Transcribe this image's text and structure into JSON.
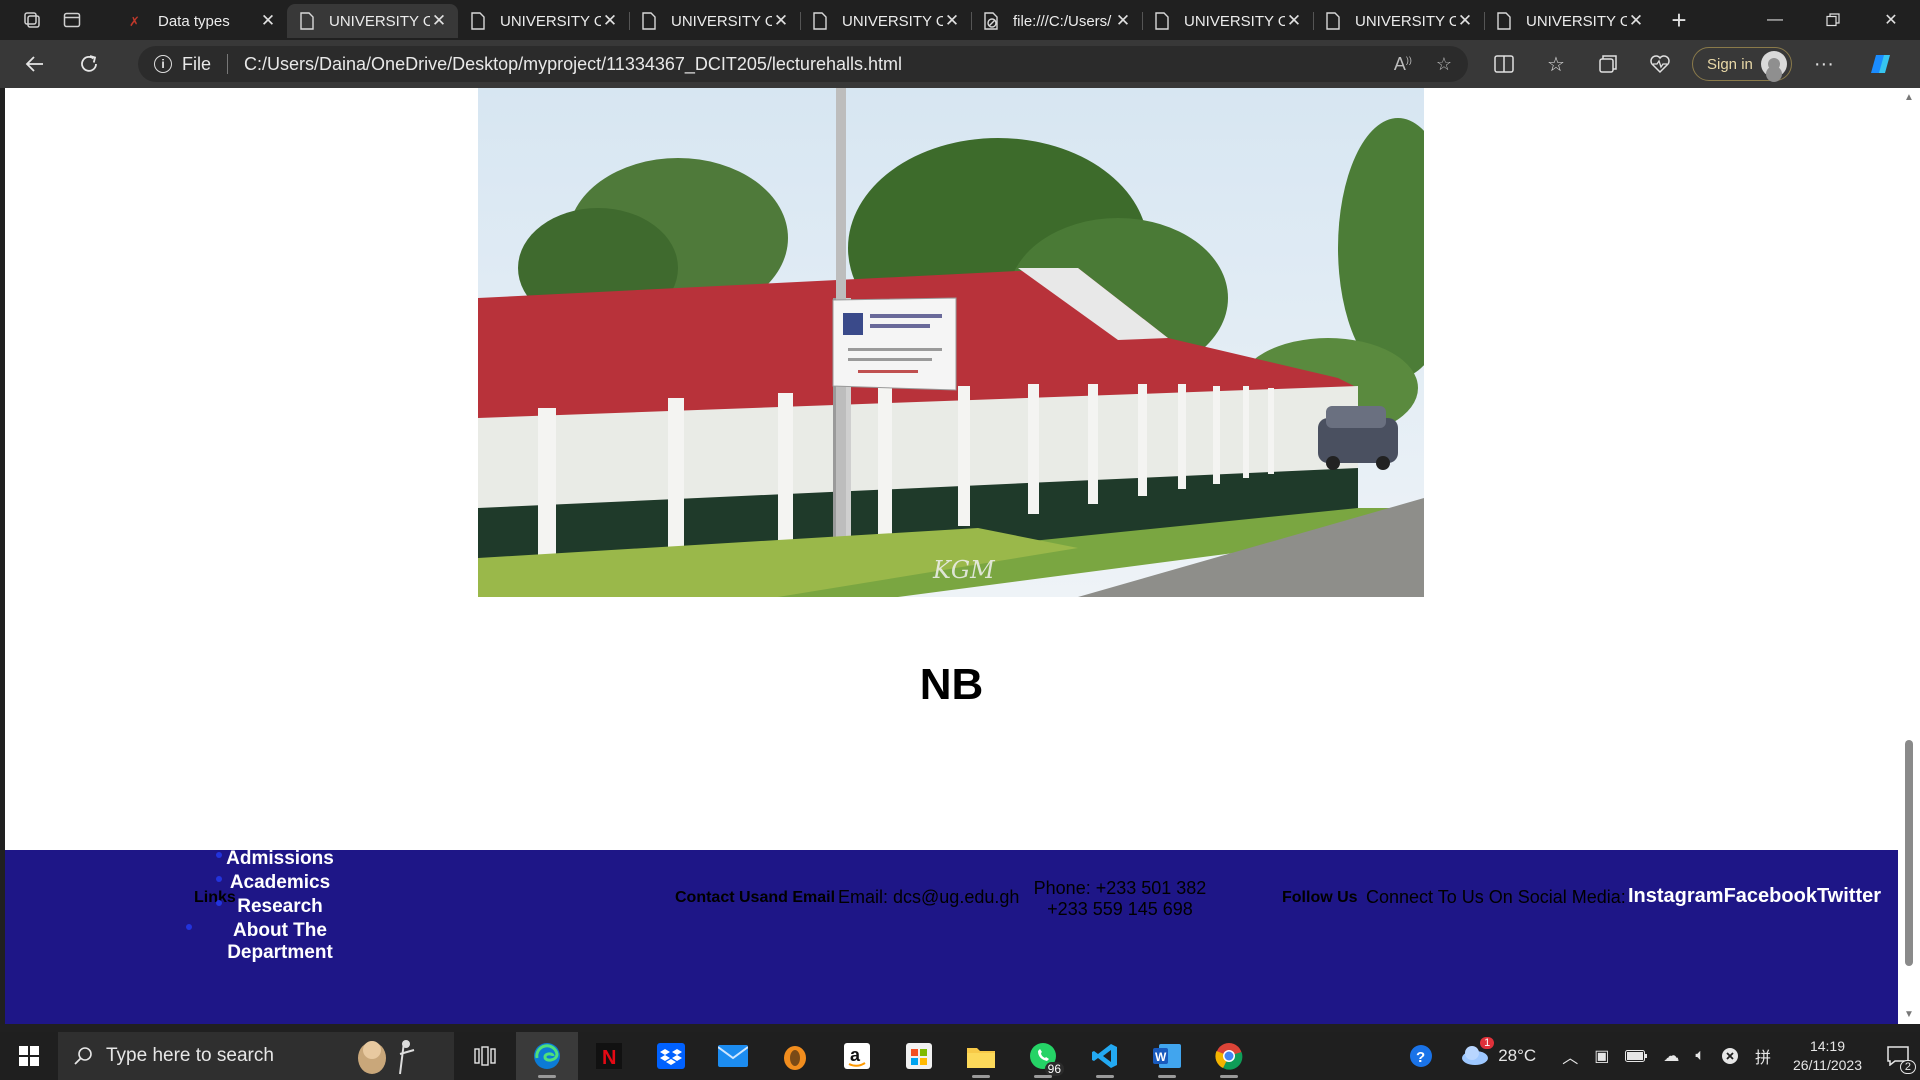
{
  "browser": {
    "tabs": [
      {
        "title": "Data types",
        "active": false,
        "icon": "app-favicon-red"
      },
      {
        "title": "UNIVERSITY OF GHANA",
        "active": true,
        "icon": "page-icon"
      },
      {
        "title": "UNIVERSITY OF GHANA",
        "active": false,
        "icon": "page-icon"
      },
      {
        "title": "UNIVERSITY OF GHANA",
        "active": false,
        "icon": "page-icon"
      },
      {
        "title": "UNIVERSITY OF GHANA",
        "active": false,
        "icon": "page-icon"
      },
      {
        "title": "file:///C:/Users/",
        "active": false,
        "icon": "file-blocked-icon"
      },
      {
        "title": "UNIVERSITY OF GHANA",
        "active": false,
        "icon": "page-icon"
      },
      {
        "title": "UNIVERSITY OF GHANA",
        "active": false,
        "icon": "page-icon"
      },
      {
        "title": "UNIVERSITY OF GHANA",
        "active": false,
        "icon": "page-icon"
      }
    ],
    "address": {
      "scheme_label": "File",
      "url": "C:/Users/Daina/OneDrive/Desktop/myproject/11334367_DCIT205/lecturehalls.html"
    },
    "signin_label": "Sign in"
  },
  "page": {
    "photo_alt": "University of Ghana lecture hall building",
    "photo_watermark": "KGM",
    "heading": "NB",
    "footer": {
      "links_label": "Links",
      "links": [
        "Admissions",
        "Academics",
        "Research",
        "About The Department"
      ],
      "contact_label": "Contact Usand Email",
      "email": "Email: dcs@ug.edu.gh",
      "phone_line1": "Phone: +233 501 382",
      "phone_line2": "+233 559 145 698",
      "follow_label": "Follow Us",
      "connect_text": "Connect To Us On Social Media:",
      "social": "InstagramFacebookTwitter"
    },
    "colors": {
      "footer_bg": "#1e1687"
    }
  },
  "taskbar": {
    "search_placeholder": "Type here to search",
    "apps": [
      "task-view-icon",
      "edge-icon",
      "netflix-icon",
      "dropbox-icon",
      "mail-icon",
      "fl-studio-icon",
      "amazon-icon",
      "store-icon",
      "file-explorer-icon",
      "whatsapp-icon",
      "vscode-icon",
      "word-icon",
      "chrome-icon"
    ],
    "whatsapp_badge": "96",
    "weather_badge": "1",
    "temperature": "28°C",
    "time": "14:19",
    "date": "26/11/2023",
    "notifications_count": "2"
  }
}
